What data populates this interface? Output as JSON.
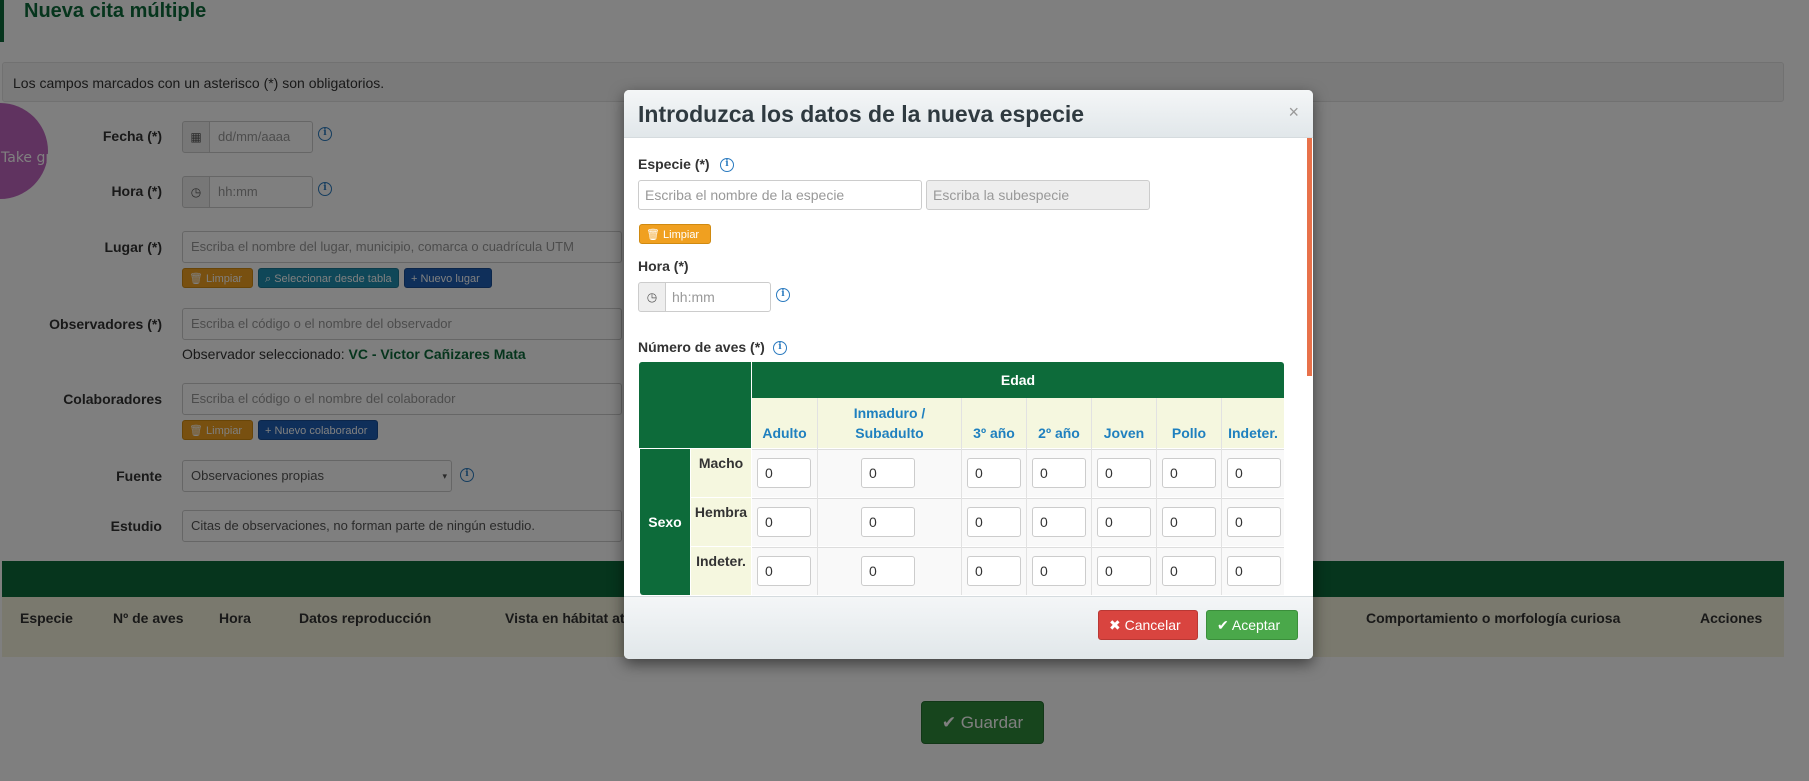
{
  "page": {
    "title": "Nueva cita múltiple",
    "notice": "Los campos marcados con un asterisco (*) son obligatorios.",
    "screenshot_label": "Take graphical screenshot",
    "fecha": {
      "label": "Fecha (*)",
      "placeholder": "dd/mm/aaaa"
    },
    "hora": {
      "label": "Hora (*)",
      "placeholder": "hh:mm"
    },
    "lugar": {
      "label": "Lugar (*)",
      "placeholder": "Escriba el nombre del lugar, municipio, comarca o cuadrícula UTM",
      "btn_limpiar": "Limpiar",
      "btn_seleccionar": "Seleccionar desde tabla",
      "btn_nuevo": "Nuevo lugar"
    },
    "observadores": {
      "label": "Observadores (*)",
      "placeholder": "Escriba el código o el nombre del observador",
      "selected_prefix": "Observador seleccionado:",
      "selected_value": "VC - Victor Cañizares Mata"
    },
    "colaboradores": {
      "label": "Colaboradores",
      "placeholder": "Escriba el código o el nombre del colaborador",
      "btn_limpiar": "Limpiar",
      "btn_nuevo": "Nuevo colaborador"
    },
    "fuente": {
      "label": "Fuente",
      "value": "Observaciones propias"
    },
    "estudio": {
      "label": "Estudio",
      "value": "Citas de observaciones, no forman parte de ningún estudio."
    },
    "table_headers": [
      "Especie",
      "Nº de aves",
      "Hora",
      "Datos reproducción",
      "Vista en hábitat at",
      "Comportamiento o morfología curiosa",
      "Acciones"
    ],
    "save_label": "Guardar"
  },
  "modal": {
    "title": "Introduzca los datos de la nueva especie",
    "close": "×",
    "especie": {
      "label": "Especie (*)",
      "placeholder": "Escriba el nombre de la especie",
      "sub_placeholder": "Escriba la subespecie",
      "btn_limpiar": "Limpiar"
    },
    "hora": {
      "label": "Hora (*)",
      "placeholder": "hh:mm"
    },
    "numero": {
      "label": "Número de aves (*)",
      "edad_header": "Edad",
      "sexo_header": "Sexo",
      "ages": [
        "Adulto",
        "Inmaduro / Subadulto",
        "3º año",
        "2º año",
        "Joven",
        "Pollo",
        "Indeter."
      ],
      "rows": [
        {
          "label": "Macho",
          "values": [
            "0",
            "0",
            "0",
            "0",
            "0",
            "0",
            "0"
          ]
        },
        {
          "label": "Hembra",
          "values": [
            "0",
            "0",
            "0",
            "0",
            "0",
            "0",
            "0"
          ]
        },
        {
          "label": "Indeter.",
          "values": [
            "0",
            "0",
            "0",
            "0",
            "0",
            "0",
            "0"
          ]
        }
      ]
    },
    "cancel_label": "Cancelar",
    "accept_label": "Aceptar"
  },
  "colors": {
    "brand_green": "#0d6b3a",
    "link_blue": "#1f80bf",
    "warning_orange": "#f0a020",
    "danger_red": "#d9443f",
    "success_green": "#4aa84a"
  }
}
